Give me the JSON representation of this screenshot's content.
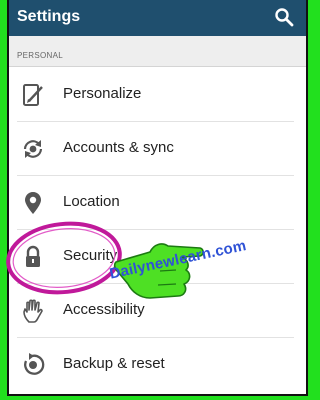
{
  "header": {
    "title": "Settings",
    "search_icon": "search-icon"
  },
  "section": {
    "label": "PERSONAL"
  },
  "items": [
    {
      "label": "Personalize",
      "icon": "personalize-icon"
    },
    {
      "label": "Accounts & sync",
      "icon": "sync-icon"
    },
    {
      "label": "Location",
      "icon": "location-pin-icon"
    },
    {
      "label": "Security",
      "icon": "lock-icon"
    },
    {
      "label": "Accessibility",
      "icon": "hand-icon"
    },
    {
      "label": "Backup & reset",
      "icon": "backup-icon"
    }
  ],
  "annotation": {
    "watermark": "Dailynewlearn.com",
    "highlight_color": "#c0199a",
    "pointer_color": "#4ee024"
  },
  "colors": {
    "appbar": "#1f4f6e",
    "frame": "#22e01e",
    "icon": "#555555"
  }
}
